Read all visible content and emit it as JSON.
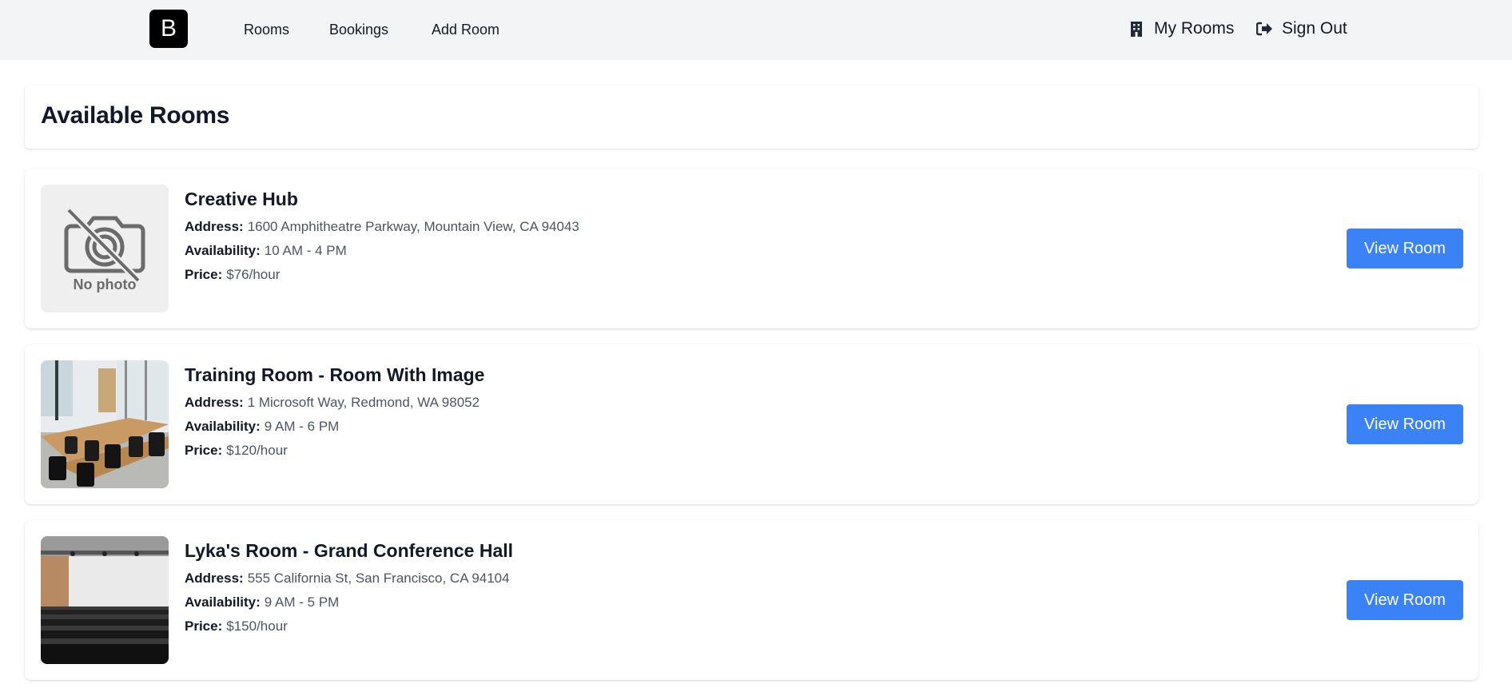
{
  "nav": {
    "logo_letter": "B",
    "links": [
      "Rooms",
      "Bookings",
      "Add Room"
    ],
    "my_rooms_label": "My Rooms",
    "sign_out_label": "Sign Out",
    "my_rooms_icon": "building-icon",
    "sign_out_icon": "sign-out-icon"
  },
  "page": {
    "title": "Available Rooms"
  },
  "labels": {
    "address": "Address:",
    "availability": "Availability:",
    "price": "Price:"
  },
  "rooms": [
    {
      "name": "Creative Hub",
      "address": "1600 Amphitheatre Parkway, Mountain View, CA 94043",
      "availability": "10 AM - 4 PM",
      "price": "$76/hour",
      "button": "View Room",
      "photo_caption": "No photo"
    },
    {
      "name": "Training Room - Room With Image",
      "address": "1 Microsoft Way, Redmond, WA 98052",
      "availability": "9 AM - 6 PM",
      "price": "$120/hour",
      "button": "View Room"
    },
    {
      "name": "Lyka's Room - Grand Conference Hall",
      "address": "555 California St, San Francisco, CA 94104",
      "availability": "9 AM - 5 PM",
      "price": "$150/hour",
      "button": "View Room"
    }
  ],
  "colors": {
    "accent": "#3b82f6",
    "nav_bg": "#f3f4f6",
    "text": "#111827",
    "muted": "#4b5563"
  }
}
